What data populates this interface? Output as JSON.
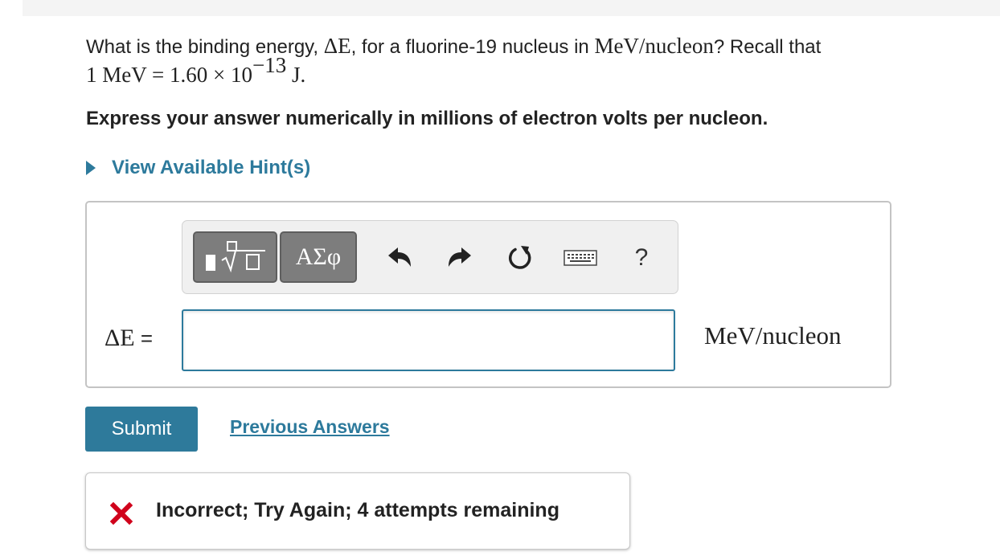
{
  "question": {
    "intro": "What is the binding energy, ",
    "symbol": "ΔE",
    "middle": ", for a fluorine-19 nucleus in ",
    "unit": "MeV/nucleon",
    "end": "? Recall that",
    "conversion_lhs": "1 MeV = 1.60 × 10",
    "conversion_exponent": "−13",
    "conversion_rhs": " J."
  },
  "instruction": "Express your answer numerically in millions of electron volts per nucleon.",
  "hint": {
    "label": "View Available Hint(s)"
  },
  "toolbar": {
    "symbols_label": "ΑΣφ",
    "help_label": "?",
    "icons": [
      "templates-icon",
      "undo-icon",
      "redo-icon",
      "reset-icon",
      "keyboard-icon",
      "help-icon"
    ]
  },
  "answer": {
    "variable": "ΔE",
    "equals": " =",
    "value": "",
    "placeholder": "",
    "units": "MeV/nucleon"
  },
  "buttons": {
    "submit": "Submit",
    "previous_answers": "Previous Answers"
  },
  "feedback": {
    "message": "Incorrect; Try Again; 4 attempts remaining",
    "status_color": "#d0021b"
  },
  "colors": {
    "accent": "#2d7a9c",
    "submit_bg": "#2e7a9b",
    "error": "#d0021b"
  }
}
